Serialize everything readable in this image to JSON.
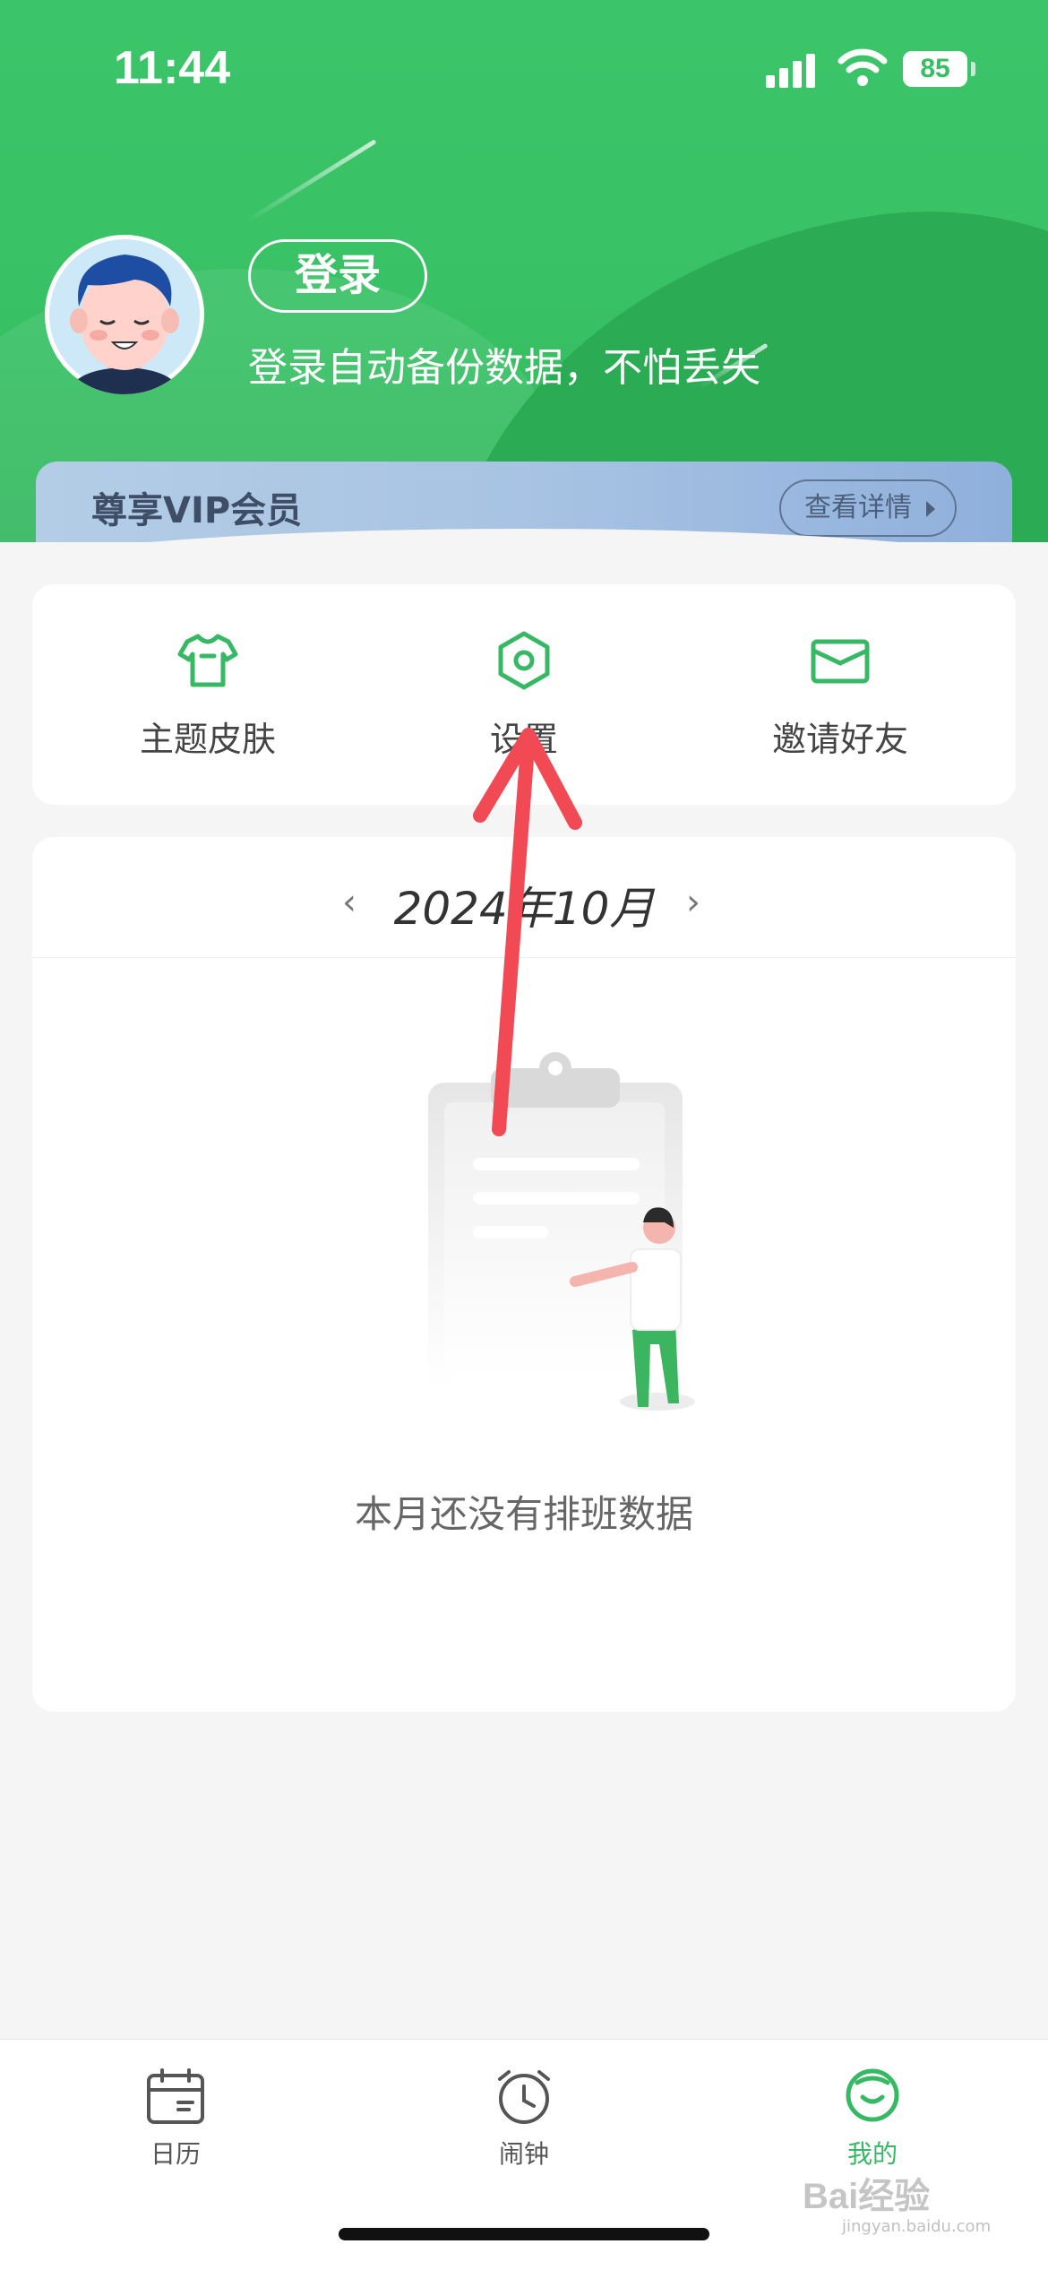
{
  "status_bar": {
    "time": "11:44",
    "battery": "85"
  },
  "profile": {
    "login_label": "登录",
    "login_hint": "登录自动备份数据，不怕丢失"
  },
  "vip": {
    "title": "尊享VIP会员",
    "details_label": "查看详情"
  },
  "menu": {
    "items": [
      {
        "label": "主题皮肤",
        "icon": "tshirt-icon"
      },
      {
        "label": "设置",
        "icon": "hexagon-settings-icon"
      },
      {
        "label": "邀请好友",
        "icon": "envelope-icon"
      }
    ]
  },
  "calendar": {
    "month_label": "2024年10月",
    "empty_message": "本月还没有排班数据"
  },
  "tabbar": {
    "items": [
      {
        "label": "日历",
        "icon": "calendar-icon",
        "active": false
      },
      {
        "label": "闹钟",
        "icon": "alarm-clock-icon",
        "active": false
      },
      {
        "label": "我的",
        "icon": "profile-face-icon",
        "active": true
      }
    ]
  },
  "watermark": {
    "brand": "Bai经验",
    "url": "jingyan.baidu.com"
  },
  "colors": {
    "brand_green": "#37be64",
    "vip_blue": "#a8c3e3",
    "arrow_red": "#f24a55"
  }
}
